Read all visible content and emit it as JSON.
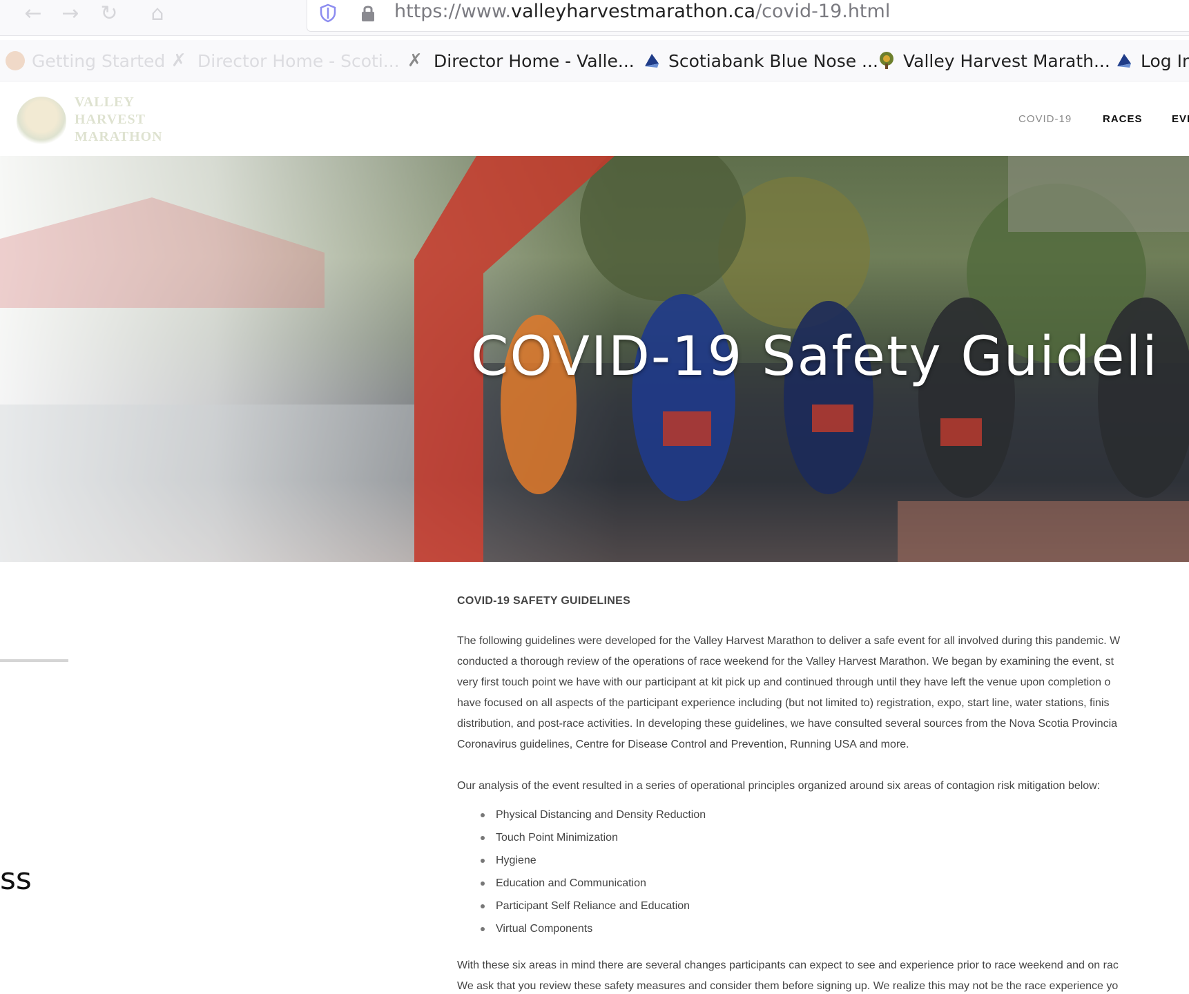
{
  "browser": {
    "url_prefix": "https://www.",
    "url_domain": "valleyharvestmarathon.ca",
    "url_path": "/covid-19.html",
    "bookmarks": [
      {
        "label": "Getting Started",
        "icon": "firefox-icon",
        "faded": true
      },
      {
        "label": "Director Home - Scoti...",
        "icon": "runner-icon",
        "faded": true
      },
      {
        "label": "Director Home - Valle...",
        "icon": "runner-icon",
        "faded": false
      },
      {
        "label": "Scotiabank Blue Nose ...",
        "icon": "bluenose-icon",
        "faded": false
      },
      {
        "label": "Valley Harvest Marath...",
        "icon": "tree-icon",
        "faded": false
      },
      {
        "label": "Log In",
        "icon": "bluenose-icon",
        "faded": false
      }
    ]
  },
  "site": {
    "logo_lines": [
      "VALLEY",
      "HARVEST",
      "MARATHON"
    ],
    "nav": [
      {
        "label": "COVID-19",
        "active": true
      },
      {
        "label": "RACES",
        "active": false
      },
      {
        "label": "EVE",
        "active": false
      }
    ]
  },
  "hero": {
    "title": "COVID-19 Safety Guideli"
  },
  "left_fragment": "ss",
  "content": {
    "heading": "COVID-19 SAFETY GUIDELINES",
    "para1": [
      "The following guidelines were developed for the Valley Harvest Marathon to deliver a safe event for all involved during this pandemic. W",
      "conducted a thorough review of the operations of race weekend for the Valley Harvest Marathon.  We began by examining the event, st",
      "very first touch point we have with our participant at kit pick up and continued through until they have left the venue upon completion o",
      "have focused on all aspects of the participant experience including (but not limited to) registration, expo, start line, water stations, finis",
      "distribution, and post-race activities. In developing these guidelines, we have consulted several sources from the Nova Scotia Provincia",
      "Coronavirus guidelines, Centre for Disease Control and Prevention, Running USA and more."
    ],
    "para2": "Our analysis of the event resulted in a series of operational principles organized around six areas of contagion risk mitigation below:",
    "bullets": [
      "Physical Distancing and Density Reduction",
      "Touch Point Minimization",
      "Hygiene",
      "Education and Communication",
      "Participant Self Reliance and Education",
      "Virtual Components"
    ],
    "para3": [
      "With these six areas in mind there are several changes participants can expect to see and experience prior to race weekend and on rac",
      "We ask that you review these safety measures and consider them before signing up.  We realize this may not be the race experience yo"
    ]
  }
}
